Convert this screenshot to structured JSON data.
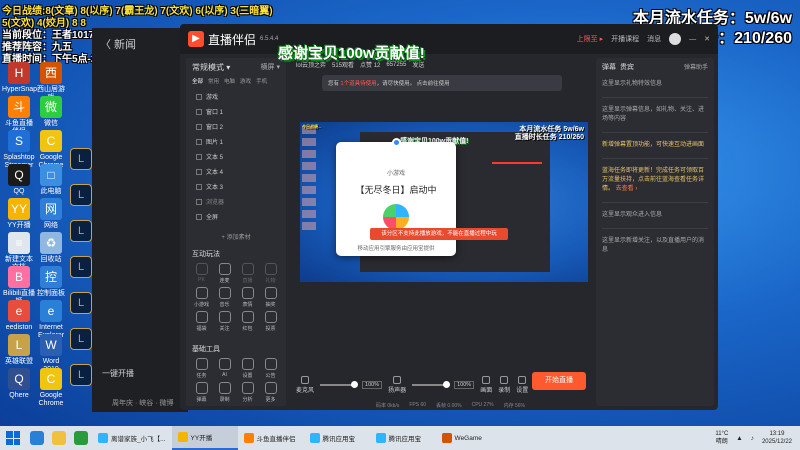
{
  "overlay_left": [
    "今日战绩:8(文章) 8(以序) 7(霸王龙) 7(文欢) 6(以序) 3(三暗翼)",
    "5(文欢) 4(姣月) 8 8",
    "当前段位：王者1017",
    "推荐阵容：九五",
    "直播时间：下午5点-24点"
  ],
  "overlay_right": {
    "task1": "本月流水任务：5w/6w",
    "task2": "直播时长任务：210/260"
  },
  "overlay_center": "感谢宝贝100w贡献值!",
  "desktop_icons": [
    {
      "label": "HyperSnap",
      "color": "#c0392b",
      "glyph": "H"
    },
    {
      "label": "西山居游戏",
      "color": "#d35400",
      "glyph": "西"
    },
    {
      "label": "斗鱼直播伴侣",
      "color": "#ff7f00",
      "glyph": "斗"
    },
    {
      "label": "微信",
      "color": "#2ecc40",
      "glyph": "微"
    },
    {
      "label": "Splashtop Streamer",
      "color": "#1f6fd6",
      "glyph": "S"
    },
    {
      "label": "Google Chrome",
      "color": "#f1c40f",
      "glyph": "C"
    },
    {
      "label": "QQ",
      "color": "#1a1a1a",
      "glyph": "Q"
    },
    {
      "label": "此电脑",
      "color": "#3b8ee0",
      "glyph": "□"
    },
    {
      "label": "YY开播",
      "color": "#f4b400",
      "glyph": "YY"
    },
    {
      "label": "网络",
      "color": "#2f7fd8",
      "glyph": "网"
    },
    {
      "label": "新建文本文档",
      "color": "#dfe6ee",
      "glyph": "≡"
    },
    {
      "label": "回收站",
      "color": "#8fb7e0",
      "glyph": "♻"
    },
    {
      "label": "Bilibili直播姬",
      "color": "#ff6fa0",
      "glyph": "B"
    },
    {
      "label": "控制面板",
      "color": "#2f7fd8",
      "glyph": "控"
    },
    {
      "label": "eediston",
      "color": "#e74c3c",
      "glyph": "e"
    },
    {
      "label": "Internet Explorer",
      "color": "#2a80d6",
      "glyph": "e"
    },
    {
      "label": "英雄联盟",
      "color": "#c7a24a",
      "glyph": "L"
    },
    {
      "label": "Word 2010",
      "color": "#2b5fb4",
      "glyph": "W"
    },
    {
      "label": "Qhere",
      "color": "#2f4f8f",
      "glyph": "Q"
    },
    {
      "label": "Google Chrome",
      "color": "#f1c40f",
      "glyph": "C"
    }
  ],
  "bg_window": {
    "title": "〈 新闻",
    "side_label": "一键开播",
    "bottom": "周年庆 · 峡谷 · 微博"
  },
  "app": {
    "name": "直播伴侣",
    "version": "6.5.4.4",
    "top_right": [
      "上限至 ▸",
      "开播课程",
      "消息"
    ],
    "left_panel": {
      "header": "常规模式 ▾",
      "header_right": "横屏 ▾",
      "tabs": [
        "全部",
        "常用",
        "电脑",
        "游戏",
        "手机"
      ],
      "sources": [
        {
          "name": "游戏",
          "dim": false
        },
        {
          "name": "窗口 1",
          "dim": false
        },
        {
          "name": "窗口 2",
          "dim": false
        },
        {
          "name": "图片 1",
          "dim": false
        },
        {
          "name": "文本 5",
          "dim": false
        },
        {
          "name": "文本 4",
          "dim": false
        },
        {
          "name": "文本 3",
          "dim": false
        },
        {
          "name": "浏览器",
          "dim": true
        },
        {
          "name": "全屏",
          "dim": false
        }
      ],
      "add_source": "+ 添加素材",
      "interact_title": "互动玩法",
      "interact_items": [
        {
          "label": "PK",
          "dim": true
        },
        {
          "label": "连麦",
          "dim": false
        },
        {
          "label": "直播",
          "dim": true
        },
        {
          "label": "礼物",
          "dim": true
        },
        {
          "label": "小游戏",
          "dim": false
        },
        {
          "label": "音乐",
          "dim": false
        },
        {
          "label": "表情",
          "dim": false
        },
        {
          "label": "抽奖",
          "dim": false
        },
        {
          "label": "福袋",
          "dim": false
        },
        {
          "label": "关注",
          "dim": false
        },
        {
          "label": "红包",
          "dim": false
        },
        {
          "label": "投票",
          "dim": false
        }
      ],
      "tools_title": "基础工具",
      "tool_items": [
        {
          "label": "任务",
          "dim": false
        },
        {
          "label": "AI",
          "dim": false
        },
        {
          "label": "设置",
          "dim": false
        },
        {
          "label": "公告",
          "dim": false
        },
        {
          "label": "弹幕",
          "dim": false
        },
        {
          "label": "录制",
          "dim": false
        },
        {
          "label": "分析",
          "dim": false
        },
        {
          "label": "更多",
          "dim": false
        }
      ]
    },
    "live_header": [
      "lol云顶之弈",
      "515观看",
      "点赞 12",
      "657255",
      "发送"
    ],
    "notice": {
      "pre": "您有 ",
      "hl": "1个道具待使用",
      "post": "，请尽快使用。 点击前往使用"
    },
    "preview": {
      "nest_left": "今日战绩...",
      "nest_task1": "本月流水任务 5w/6w",
      "nest_task2": "直播时长任务 210/260",
      "nest_center": "感谢宝贝100w贡献值!"
    },
    "game_card": {
      "label": "小游戏",
      "title": "【无尽冬日】启动中",
      "provider": "移动应用引擎服务由应用宝提供"
    },
    "error_bar": "该分区不支持此播放游戏，不能在直播过程中玩",
    "controls": {
      "mic": "麦克风",
      "mic_pct": "100%",
      "speaker": "扬声器",
      "spk_pct": "100%",
      "btns": [
        "画面",
        "录制",
        "设置"
      ]
    },
    "start_button": "开始直播",
    "status": [
      "码率 0kb/s",
      "FPS 60",
      "丢帧 0.00%",
      "CPU 27%",
      "内存 56%"
    ],
    "right_panel": {
      "tabs": [
        "弹幕",
        "贵宾"
      ],
      "tab_right": "弹幕助手",
      "blocks": [
        {
          "text": "这里显示礼物特效信息",
          "hl": false
        },
        {
          "text": "这里显示弹幕信息，如礼物、关注、进场等内容",
          "hl": false
        },
        {
          "text": "新增弹幕置顶功能，可快速互动进画面",
          "hl": true
        },
        {
          "text": "蓝海任务即将更新！完成任务可领取百万流量扶持，点击前往蓝海查看任务详情。",
          "hl": true,
          "more": "去查看 ›"
        },
        {
          "text": "这里显示观众进入信息",
          "hl": false
        },
        {
          "text": "这里显示新增关注，以及直播用户的消息",
          "hl": false
        }
      ]
    }
  },
  "taskbar": {
    "tasks": [
      {
        "label": "离谱家族_小飞【...",
        "color": "#2fb4ff",
        "active": false
      },
      {
        "label": "YY开播",
        "color": "#f4b400",
        "active": true
      },
      {
        "label": "斗鱼直播伴侣",
        "color": "#ff7f00",
        "active": false
      },
      {
        "label": "腾讯应用宝",
        "color": "#2fb4ff",
        "active": false
      },
      {
        "label": "腾讯应用宝",
        "color": "#2fb4ff",
        "active": false
      },
      {
        "label": "WeGame",
        "color": "#d35400",
        "active": false
      }
    ],
    "weather": "11°C",
    "weather_desc": "晴朗",
    "time": "13:19",
    "date": "2025/12/22"
  }
}
